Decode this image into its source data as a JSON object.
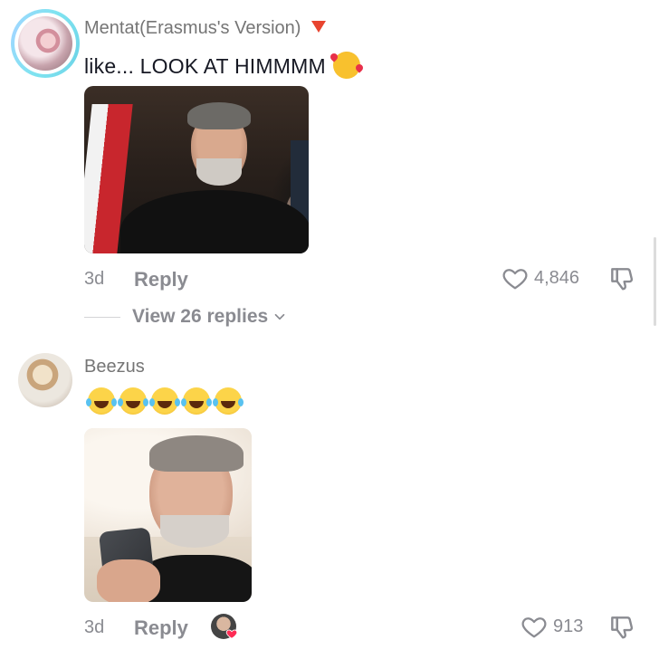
{
  "comments": [
    {
      "username": "Mentat(Erasmus's Version)",
      "text": "like... LOOK AT HIMMMM",
      "emoji": "smiling-face-with-hearts",
      "age": "3d",
      "reply_label": "Reply",
      "likes": "4,846",
      "view_replies": "View 26 replies"
    },
    {
      "username": "Beezus",
      "emoji_count": 5,
      "emoji": "face-with-tears-of-joy",
      "age": "3d",
      "reply_label": "Reply",
      "likes": "913",
      "creator_liked": true
    }
  ],
  "colors": {
    "text_primary": "#161823",
    "text_secondary": "#8a8b91",
    "flag": "#e8442f",
    "creator_heart": "#fe2c55"
  }
}
